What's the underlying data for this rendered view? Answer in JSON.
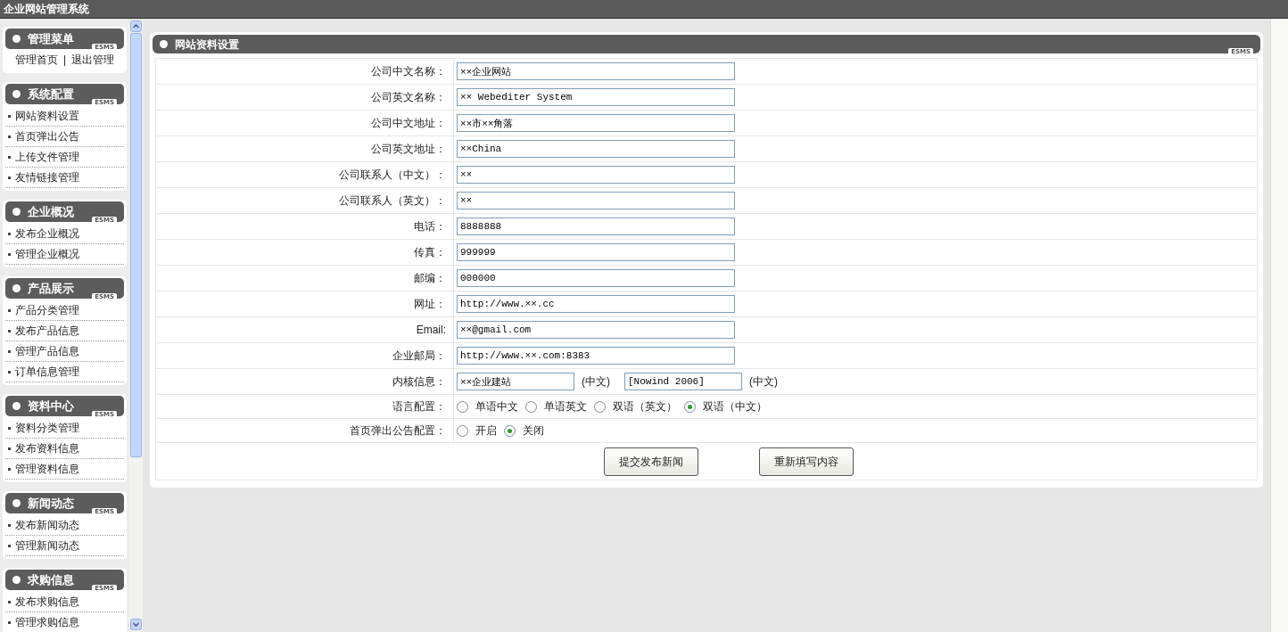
{
  "window": {
    "title": "企业网站管理系统"
  },
  "sidebar": {
    "sections": [
      {
        "title": "管理菜单",
        "badge": "ESMS",
        "kind": "links",
        "links": [
          "管理首页",
          "退出管理"
        ],
        "separator": "|"
      },
      {
        "title": "系统配置",
        "badge": "ESMS",
        "kind": "list",
        "items": [
          "网站资料设置",
          "首页弹出公告",
          "上传文件管理",
          "友情链接管理"
        ]
      },
      {
        "title": "企业概况",
        "badge": "ESMS",
        "kind": "list",
        "items": [
          "发布企业概况",
          "管理企业概况"
        ]
      },
      {
        "title": "产品展示",
        "badge": "ESMS",
        "kind": "list",
        "items": [
          "产品分类管理",
          "发布产品信息",
          "管理产品信息",
          "订单信息管理"
        ]
      },
      {
        "title": "资料中心",
        "badge": "ESMS",
        "kind": "list",
        "items": [
          "资料分类管理",
          "发布资料信息",
          "管理资料信息"
        ]
      },
      {
        "title": "新闻动态",
        "badge": "ESMS",
        "kind": "list",
        "items": [
          "发布新闻动态",
          "管理新闻动态"
        ]
      },
      {
        "title": "求购信息",
        "badge": "ESMS",
        "kind": "list",
        "items": [
          "发布求购信息",
          "管理求购信息"
        ]
      }
    ]
  },
  "panel": {
    "title": "网站资料设置",
    "badge": "ESMS",
    "rows": [
      {
        "kind": "text",
        "label": "公司中文名称：",
        "value": "××企业网站"
      },
      {
        "kind": "text",
        "label": "公司英文名称：",
        "value": "×× Webediter System"
      },
      {
        "kind": "text",
        "label": "公司中文地址：",
        "value": "××市××角落"
      },
      {
        "kind": "text",
        "label": "公司英文地址：",
        "value": "××China"
      },
      {
        "kind": "text",
        "label": "公司联系人（中文）：",
        "value": "××"
      },
      {
        "kind": "text",
        "label": "公司联系人（英文）：",
        "value": "××"
      },
      {
        "kind": "text",
        "label": "电话：",
        "value": "8888888"
      },
      {
        "kind": "text",
        "label": "传真：",
        "value": "999999"
      },
      {
        "kind": "text",
        "label": "邮编：",
        "value": "000000"
      },
      {
        "kind": "text",
        "label": "网址：",
        "value": "http://www.××.cc"
      },
      {
        "kind": "text",
        "label": "Email:",
        "value": "××@gmail.com"
      },
      {
        "kind": "text",
        "label": "企业邮局：",
        "value": "http://www.××.com:8383"
      },
      {
        "kind": "pair",
        "label": "内核信息：",
        "fields": [
          {
            "value": "××企业建站",
            "note": "(中文)"
          },
          {
            "value": "[Nowind 2006]",
            "note": "(中文)"
          }
        ]
      },
      {
        "kind": "radio",
        "label": "语言配置：",
        "options": [
          {
            "label": "单语中文",
            "selected": false
          },
          {
            "label": "单语英文",
            "selected": false
          },
          {
            "label": "双语（英文）",
            "selected": false
          },
          {
            "label": "双语（中文）",
            "selected": true
          }
        ]
      },
      {
        "kind": "radio",
        "label": "首页弹出公告配置：",
        "options": [
          {
            "label": "开启",
            "selected": false
          },
          {
            "label": "关闭",
            "selected": true
          }
        ]
      }
    ],
    "buttons": [
      "提交发布新闻",
      "重新填写内容"
    ]
  }
}
